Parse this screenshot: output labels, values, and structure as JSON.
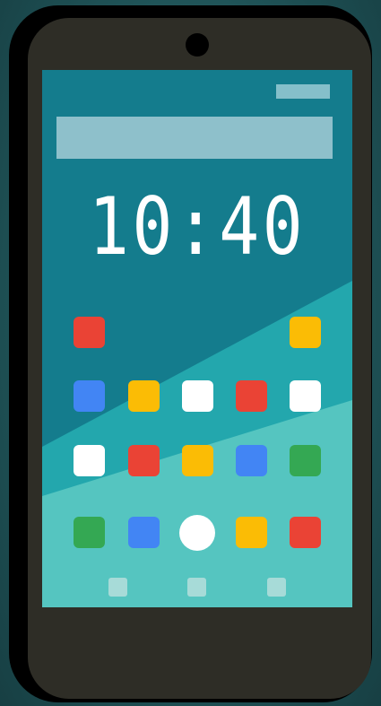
{
  "clock": {
    "time": "10:40"
  },
  "colors": {
    "screen_dark": "#147c8d",
    "screen_mid": "#23a7ad",
    "screen_light": "#55c5c0",
    "red": "#ea4335",
    "yellow": "#fbbc05",
    "blue": "#4285f4",
    "green": "#34a853",
    "white": "#ffffff",
    "phone_body": "#2e2d26"
  },
  "app_rows": [
    {
      "icons": [
        "red-app-icon",
        "yellow-app-icon"
      ]
    },
    {
      "icons": [
        "blue-app-icon",
        "yellow-app-icon",
        "white-app-icon",
        "red-app-icon",
        "white-app-icon"
      ]
    },
    {
      "icons": [
        "white-app-icon",
        "red-app-icon",
        "yellow-app-icon",
        "blue-app-icon",
        "green-app-icon"
      ]
    },
    {
      "icons": [
        "green-app-icon",
        "blue-app-icon",
        "white-circle-icon",
        "yellow-app-icon",
        "red-app-icon"
      ]
    }
  ],
  "nav_buttons": [
    "nav-back-icon",
    "nav-home-icon",
    "nav-recent-icon"
  ]
}
